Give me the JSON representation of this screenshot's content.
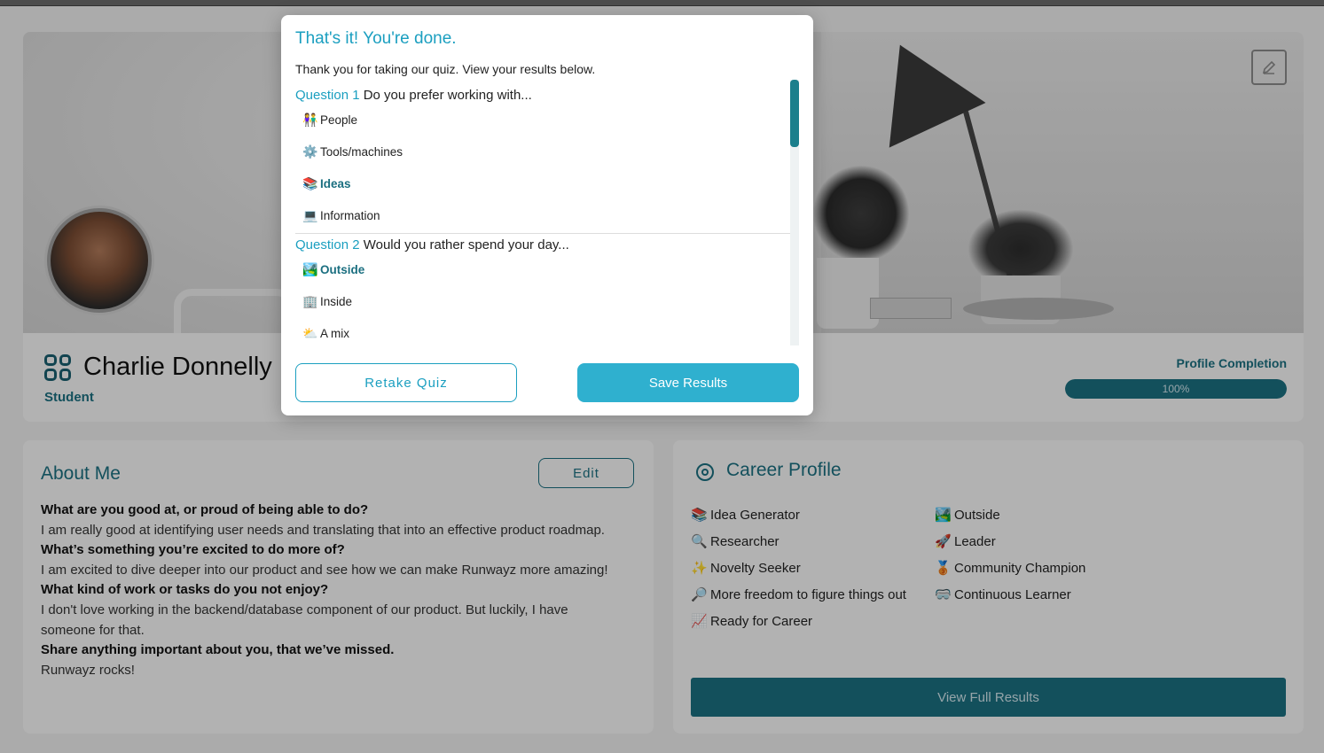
{
  "profile": {
    "name": "Charlie Donnelly",
    "role": "Student",
    "completion_label": "Profile Completion",
    "completion_text": "100%",
    "completion_value": 1.0
  },
  "about": {
    "title": "About Me",
    "edit_label": "Edit",
    "qa": [
      {
        "q": "What are you good at, or proud of being able to do?",
        "a": "I am really good at identifying user needs and translating that into an effective product roadmap."
      },
      {
        "q": "What’s something you’re excited to do more of?",
        "a": "I am excited to dive deeper into our product and see how we can make Runwayz more amazing!"
      },
      {
        "q": "What kind of work or tasks do you not enjoy?",
        "a": "I don't love working in the backend/database component of our product. But luckily, I have someone for that."
      },
      {
        "q": "Share anything important about you, that we’ve missed.",
        "a": "Runwayz rocks!"
      }
    ]
  },
  "career": {
    "title": "Career Profile",
    "col1": [
      {
        "emoji": "📚",
        "label": "Idea Generator"
      },
      {
        "emoji": "🔍",
        "label": "Researcher"
      },
      {
        "emoji": "✨",
        "label": "Novelty Seeker"
      },
      {
        "emoji": "🔎",
        "label": "More freedom to figure things out"
      },
      {
        "emoji": "📈",
        "label": "Ready for Career"
      }
    ],
    "col2": [
      {
        "emoji": "🏞️",
        "label": "Outside"
      },
      {
        "emoji": "🚀",
        "label": "Leader"
      },
      {
        "emoji": "🥉",
        "label": "Community Champion"
      },
      {
        "emoji": "🥽",
        "label": "Continuous Learner"
      }
    ],
    "view_full_label": "View Full Results"
  },
  "modal": {
    "title": "That's it! You're done.",
    "subtitle": "Thank you for taking our quiz. View your results below.",
    "questions": [
      {
        "num": "Question 1",
        "text": "Do you prefer working with...",
        "options": [
          {
            "emoji": "👫",
            "label": "People",
            "selected": false
          },
          {
            "emoji": "⚙️",
            "label": "Tools/machines",
            "selected": false
          },
          {
            "emoji": "📚",
            "label": "Ideas",
            "selected": true
          },
          {
            "emoji": "💻",
            "label": "Information",
            "selected": false
          }
        ]
      },
      {
        "num": "Question 2",
        "text": "Would you rather spend your day...",
        "options": [
          {
            "emoji": "🏞️",
            "label": "Outside",
            "selected": true
          },
          {
            "emoji": "🏢",
            "label": "Inside",
            "selected": false
          },
          {
            "emoji": "⛅",
            "label": "A mix",
            "selected": false
          }
        ]
      }
    ],
    "retake_label": "Retake Quiz",
    "save_label": "Save Results"
  },
  "colors": {
    "accent": "#1b9fc0",
    "brand_dark": "#1b6f80",
    "save_button": "#2fb0cf"
  }
}
